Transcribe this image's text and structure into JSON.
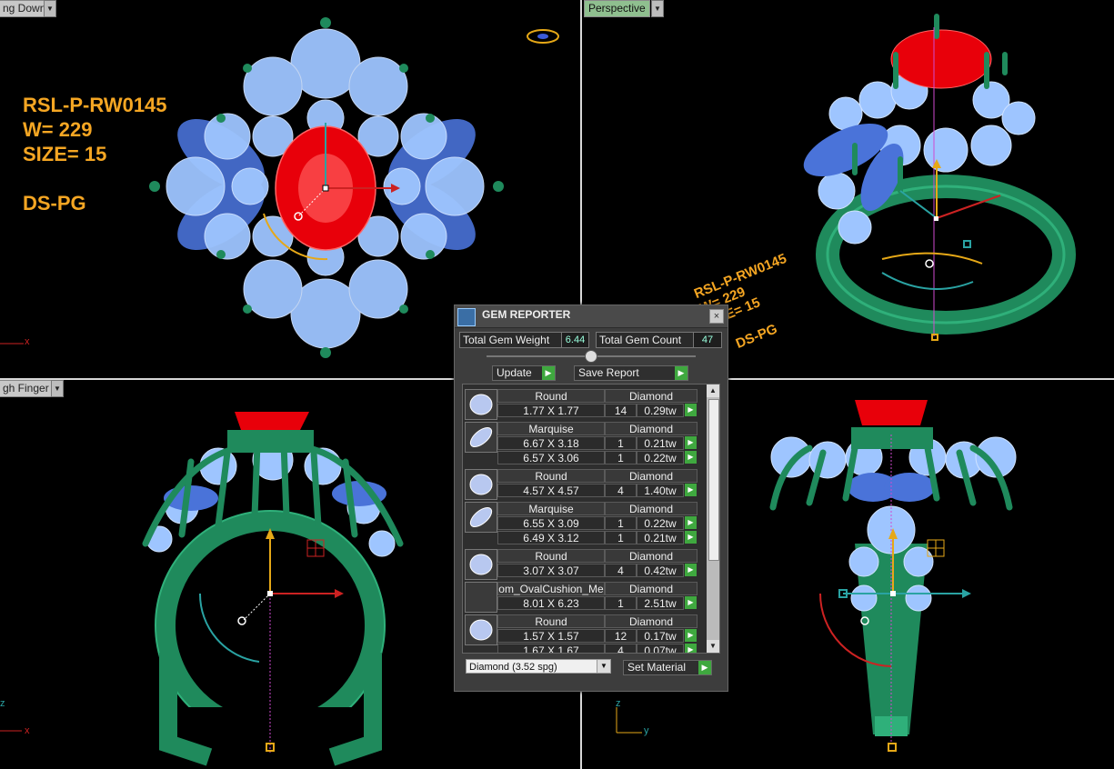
{
  "viewports": {
    "top_left": {
      "label": "ng Down",
      "stamp": [
        "RSL-P-RW0145",
        "W= 229",
        "SIZE= 15",
        "",
        "DS-PG"
      ],
      "axis": "x"
    },
    "top_right": {
      "label": "Perspective",
      "stamp": [
        "RSL-P-RW0145",
        "W= 229",
        "SIZE= 15",
        "",
        "DS-PG"
      ]
    },
    "bottom_left": {
      "label": "gh Finger",
      "axis_x": "x",
      "axis_z": "z"
    },
    "bottom_right": {
      "axis_y": "y",
      "axis_z": "z"
    }
  },
  "dialog": {
    "title": "GEM REPORTER",
    "close": "×",
    "total_weight_label": "Total Gem Weight",
    "total_weight": "6.44",
    "total_count_label": "Total Gem Count",
    "total_count": "47",
    "update_label": "Update",
    "save_label": "Save Report",
    "go": "▶",
    "scroll_up": "▲",
    "scroll_down": "▼",
    "groups": [
      {
        "shape": "Round",
        "material": "Diamond",
        "thumb": "round",
        "rows": [
          {
            "size": "1.77 X 1.77",
            "qty": "14",
            "weight": "0.29tw"
          }
        ]
      },
      {
        "shape": "Marquise",
        "material": "Diamond",
        "thumb": "marquise",
        "rows": [
          {
            "size": "6.67 X 3.18",
            "qty": "1",
            "weight": "0.21tw"
          },
          {
            "size": "6.57 X 3.06",
            "qty": "1",
            "weight": "0.22tw"
          }
        ]
      },
      {
        "shape": "Round",
        "material": "Diamond",
        "thumb": "round",
        "rows": [
          {
            "size": "4.57 X 4.57",
            "qty": "4",
            "weight": "1.40tw"
          }
        ]
      },
      {
        "shape": "Marquise",
        "material": "Diamond",
        "thumb": "marquise",
        "rows": [
          {
            "size": "6.55 X 3.09",
            "qty": "1",
            "weight": "0.22tw"
          },
          {
            "size": "6.49 X 3.12",
            "qty": "1",
            "weight": "0.21tw"
          }
        ]
      },
      {
        "shape": "Round",
        "material": "Diamond",
        "thumb": "round",
        "rows": [
          {
            "size": "3.07 X 3.07",
            "qty": "4",
            "weight": "0.42tw"
          }
        ]
      },
      {
        "shape": "om_OvalCushion_Me",
        "material": "Diamond",
        "thumb": "none",
        "rows": [
          {
            "size": "8.01 X 6.23",
            "qty": "1",
            "weight": "2.51tw"
          }
        ]
      },
      {
        "shape": "Round",
        "material": "Diamond",
        "thumb": "round",
        "rows": [
          {
            "size": "1.57 X 1.57",
            "qty": "12",
            "weight": "0.17tw"
          },
          {
            "size": "1.67 X 1.67",
            "qty": "4",
            "weight": "0.07tw"
          }
        ]
      }
    ],
    "material_select": "Diamond      (3.52 spg)",
    "set_material_label": "Set Material"
  },
  "colors": {
    "gold": "#f5a623",
    "metal": "#1f8a5c",
    "gem_blue": "#9ec5ff",
    "gem_red": "#e8000a",
    "accent_green": "#3fa83f"
  }
}
